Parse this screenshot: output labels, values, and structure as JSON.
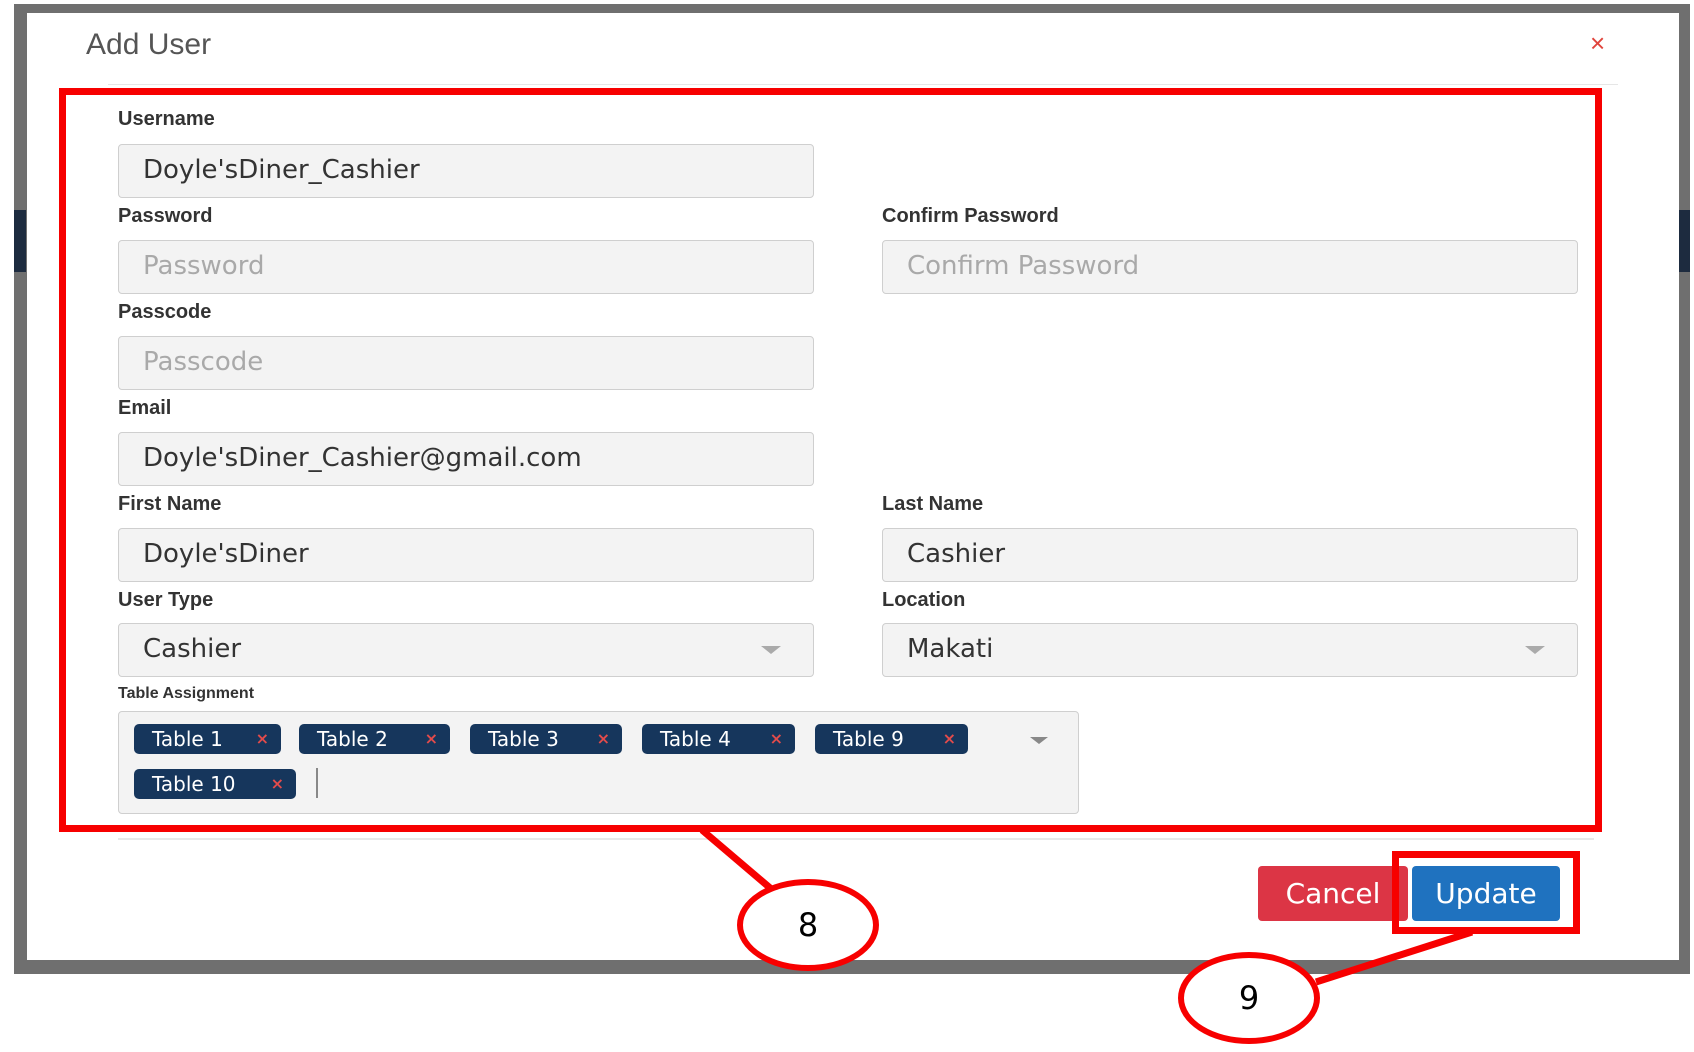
{
  "modal": {
    "title": "Add User",
    "close_glyph": "×"
  },
  "form": {
    "username": {
      "label": "Username",
      "value": "Doyle'sDiner_Cashier"
    },
    "password": {
      "label": "Password",
      "placeholder": "Password"
    },
    "confirm_password": {
      "label": "Confirm Password",
      "placeholder": "Confirm Password"
    },
    "passcode": {
      "label": "Passcode",
      "placeholder": "Passcode"
    },
    "email": {
      "label": "Email",
      "value": "Doyle'sDiner_Cashier@gmail.com"
    },
    "first_name": {
      "label": "First Name",
      "value": "Doyle'sDiner"
    },
    "last_name": {
      "label": "Last Name",
      "value": "Cashier"
    },
    "user_type": {
      "label": "User Type",
      "value": "Cashier"
    },
    "location": {
      "label": "Location",
      "value": "Makati"
    },
    "table_assignment": {
      "label": "Table Assignment",
      "chips": [
        "Table 1",
        "Table 2",
        "Table 3",
        "Table 4",
        "Table 9",
        "Table 10"
      ],
      "remove_glyph": "×"
    }
  },
  "buttons": {
    "cancel": "Cancel",
    "update": "Update"
  },
  "annotations": {
    "callout_1": "8",
    "callout_2": "9",
    "color": "#f70000"
  },
  "colors": {
    "chip_bg": "#16365c",
    "cancel_bg": "#dc3545",
    "update_bg": "#1f72bf"
  }
}
